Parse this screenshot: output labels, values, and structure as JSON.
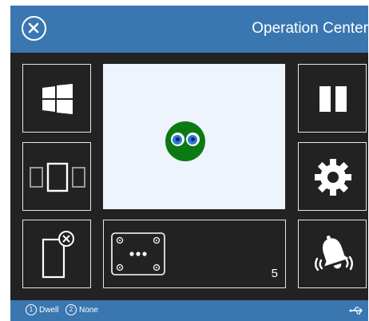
{
  "header": {
    "title": "Operation Center",
    "close_icon": "close-circle-icon"
  },
  "tiles": {
    "windows": {
      "icon": "windows-logo-icon"
    },
    "window_switch": {
      "icon": "window-switch-icon"
    },
    "exit_app": {
      "icon": "exit-app-icon"
    },
    "more": {
      "icon": "more-dots-icon",
      "count": "5"
    },
    "pause": {
      "icon": "pause-icon"
    },
    "settings": {
      "icon": "gear-icon"
    },
    "alarm": {
      "icon": "bell-icon"
    }
  },
  "preview": {
    "icon": "eyes-icon"
  },
  "statusbar": {
    "mode1_num": "1",
    "mode1_label": "Dwell",
    "mode2_num": "2",
    "mode2_label": "None",
    "connection_icon": "usb-icon"
  },
  "colors": {
    "header": "#3a77b1",
    "background": "#222222",
    "preview": "#eef4fc",
    "ball": "#0c7a12"
  }
}
